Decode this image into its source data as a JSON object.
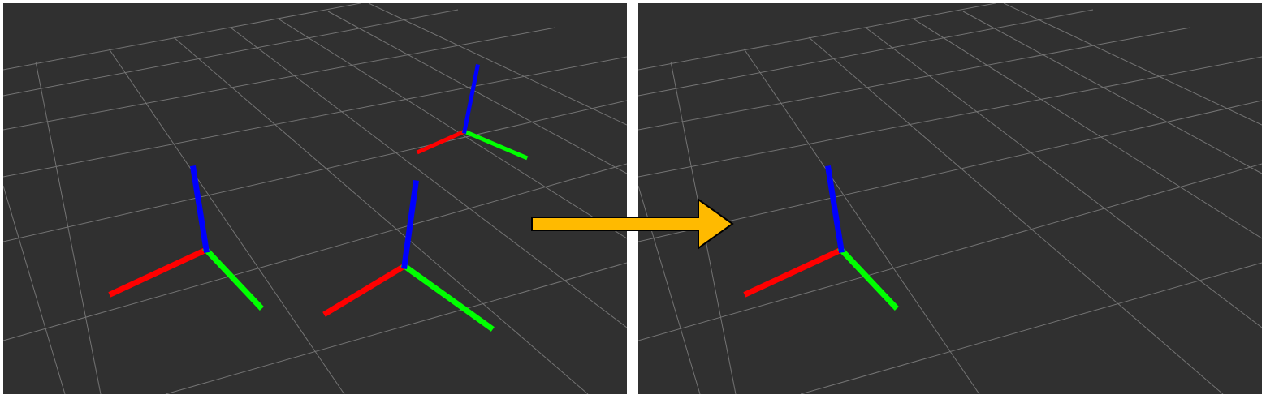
{
  "colors": {
    "background": "#303030",
    "grid": "#8a8a8a",
    "x_axis": "#ff0000",
    "y_axis": "#00ff00",
    "z_axis": "#0000ff",
    "arrow_fill": "#ffba00",
    "arrow_stroke": "#000000",
    "separator": "#ffffff"
  },
  "panels": [
    {
      "name": "before-viewport",
      "frame_count": 3
    },
    {
      "name": "after-viewport",
      "frame_count": 1
    }
  ],
  "icons": {
    "transition": "right-arrow-icon",
    "frame": "coordinate-frame-axes-icon"
  }
}
